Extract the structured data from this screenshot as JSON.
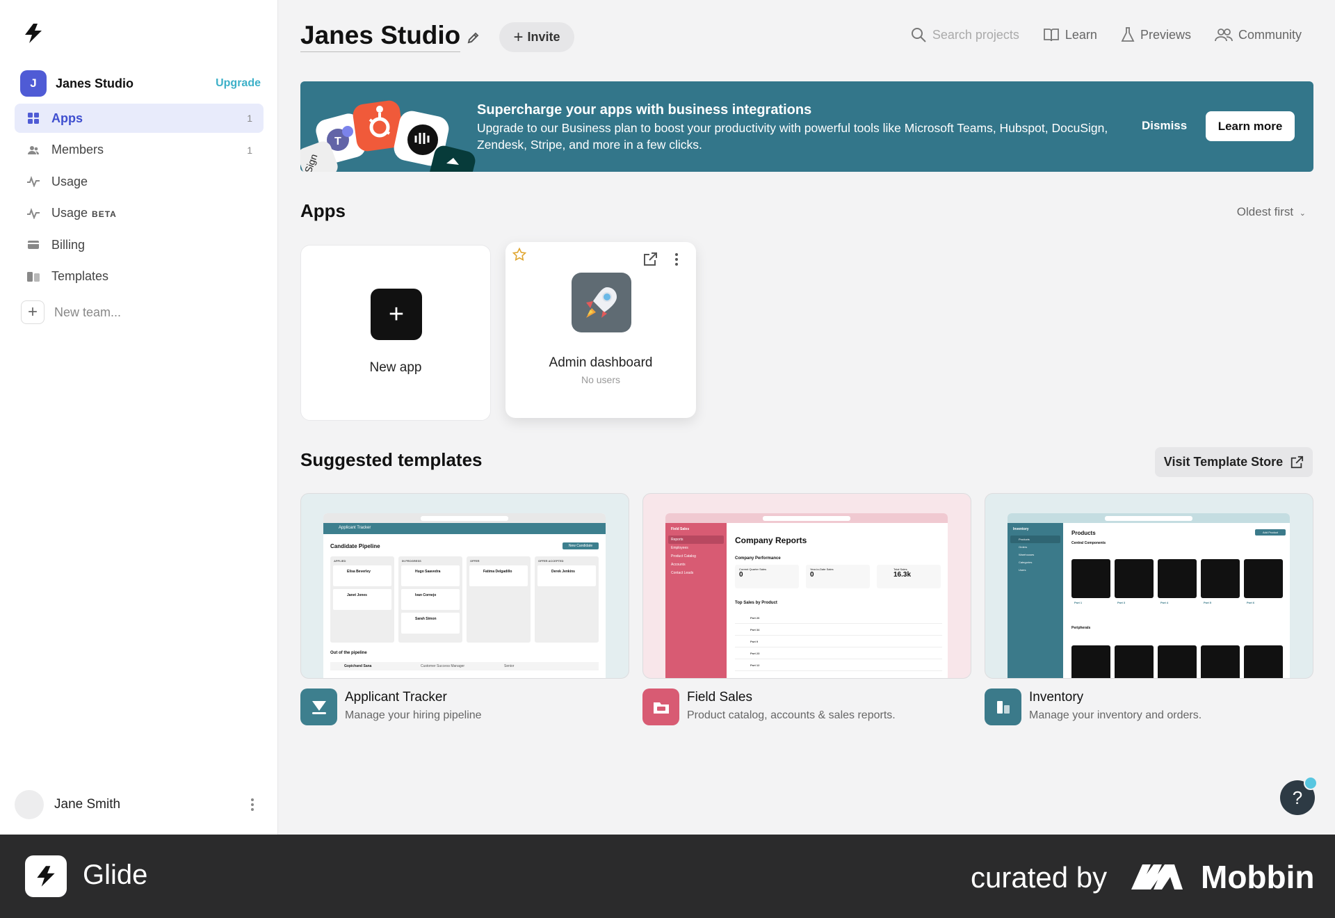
{
  "sidebar": {
    "team": {
      "initial": "J",
      "name": "Janes Studio",
      "upgrade_label": "Upgrade"
    },
    "items": [
      {
        "label": "Apps",
        "count": "1",
        "icon": "grid-icon"
      },
      {
        "label": "Members",
        "count": "1",
        "icon": "members-icon"
      },
      {
        "label": "Usage",
        "count": "",
        "icon": "pulse-icon"
      },
      {
        "label": "Usage",
        "badge": "BETA",
        "count": "",
        "icon": "pulse-icon"
      },
      {
        "label": "Billing",
        "count": "",
        "icon": "card-icon"
      },
      {
        "label": "Templates",
        "count": "",
        "icon": "templates-icon"
      }
    ],
    "new_team_label": "New team...",
    "user_name": "Jane Smith"
  },
  "header": {
    "title": "Janes Studio",
    "invite_label": "Invite",
    "search_placeholder": "Search projects",
    "links": [
      "Learn",
      "Previews",
      "Community"
    ]
  },
  "banner": {
    "title": "Supercharge your apps with business integrations",
    "text": "Upgrade to our Business plan to boost your productivity with powerful tools like Microsoft Teams, Hubspot, DocuSign, Zendesk, Stripe, and more in a few clicks.",
    "dismiss_label": "Dismiss",
    "learn_more_label": "Learn more",
    "art_sign_text": "Sign"
  },
  "apps": {
    "title": "Apps",
    "sort_label": "Oldest first",
    "new_app_label": "New app",
    "cards": [
      {
        "name": "Admin dashboard",
        "users": "No users"
      }
    ]
  },
  "templates": {
    "title": "Suggested templates",
    "visit_store_label": "Visit Template Store",
    "items": [
      {
        "name": "Applicant Tracker",
        "desc": "Manage your hiring pipeline",
        "color": "#3d7f8e"
      },
      {
        "name": "Field Sales",
        "desc": "Product catalog, accounts & sales reports.",
        "color": "#d85b73"
      },
      {
        "name": "Inventory",
        "desc": "Manage your inventory and orders.",
        "color": "#3b7a8a"
      }
    ],
    "previews": {
      "applicant": {
        "app_title": "Applicant Tracker",
        "heading": "Candidate Pipeline",
        "button": "New Candidate",
        "section": "Out of the pipeline",
        "row": [
          "Gopichand Sana",
          "Customer Success Manager",
          "Senior"
        ],
        "columns": [
          {
            "label": "APPLIED",
            "cards": [
              "Elisa Beverley",
              "Janet Jones"
            ]
          },
          {
            "label": "IN PROGRESS",
            "cards": [
              "Hugo Saavedra",
              "Ivan Cornejo",
              "Sarah Simon"
            ]
          },
          {
            "label": "OFFER",
            "cards": [
              "Fatima Delgadillo"
            ]
          },
          {
            "label": "OFFER ACCEPTED",
            "cards": [
              "Derek Jenkins"
            ]
          }
        ]
      },
      "sales": {
        "sidebar_title": "Field Sales",
        "nav": [
          "Reports",
          "Employees",
          "Product Catalog",
          "Accounts",
          "Contact Leads"
        ],
        "heading": "Company Reports",
        "section": "Company Performance",
        "stats": [
          {
            "label": "Current Quarter Sales",
            "value": "0"
          },
          {
            "label": "Year-to-Date Sales",
            "value": "0"
          },
          {
            "label": "Total Sales",
            "value": "16.3k"
          }
        ],
        "table_title": "Top Sales by Product",
        "rows": [
          "Part 26",
          "Part 34",
          "Part 9",
          "Part 23",
          "Part 12"
        ]
      },
      "inventory": {
        "sidebar_title": "Inventory",
        "nav": [
          "Products",
          "Orders",
          "Warehouses",
          "Categories",
          "Users"
        ],
        "heading": "Products",
        "button": "Add Product",
        "section1": "Central Components",
        "section2": "Peripherals",
        "parts": [
          "Part 1",
          "Part 3",
          "Part 4",
          "Part 5",
          "Part 6"
        ]
      }
    }
  },
  "footer": {
    "brand": "Glide",
    "curated": "curated by",
    "mobbin": "Mobbin"
  },
  "help_label": "?"
}
